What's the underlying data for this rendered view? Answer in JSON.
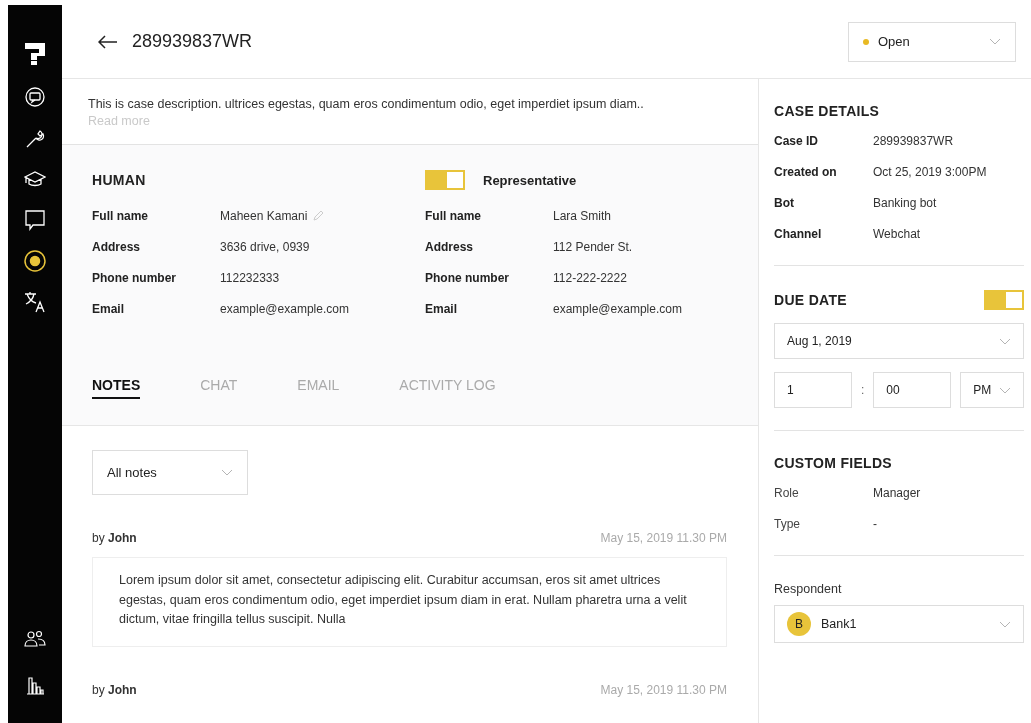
{
  "sidebar": {
    "items": [
      {
        "kind": "chat-sync",
        "selected": false
      },
      {
        "kind": "wrench",
        "selected": false
      },
      {
        "kind": "cap",
        "selected": false
      },
      {
        "kind": "bubble",
        "selected": false
      },
      {
        "kind": "target",
        "selected": true
      },
      {
        "kind": "translate",
        "selected": false
      }
    ],
    "bottom_items": [
      {
        "kind": "people",
        "selected": false
      },
      {
        "kind": "chart",
        "selected": false
      }
    ]
  },
  "header": {
    "title": "289939837WR",
    "status": {
      "label": "Open",
      "color": "#e8b923"
    }
  },
  "description": {
    "text": "This is case description. ultrices egestas, quam eros condimentum odio, eget imperdiet ipsum diam..",
    "link": "Read more"
  },
  "human": {
    "title": "HUMAN",
    "fields": [
      {
        "label": "Full name",
        "value": "Maheen Kamani",
        "editable": true
      },
      {
        "label": "Address",
        "value": "3636 drive, 0939",
        "editable": false
      },
      {
        "label": "Phone number",
        "value": "112232333",
        "editable": false
      },
      {
        "label": "Email",
        "value": "example@example.com",
        "editable": false
      }
    ]
  },
  "representative": {
    "title": "Representative",
    "on": true,
    "fields": [
      {
        "label": "Full name",
        "value": "Lara Smith"
      },
      {
        "label": "Address",
        "value": "112 Pender St."
      },
      {
        "label": "Phone number",
        "value": "112-222-2222"
      },
      {
        "label": "Email",
        "value": "example@example.com"
      }
    ]
  },
  "tabs": [
    {
      "label": "NOTES",
      "selected": true
    },
    {
      "label": "CHAT",
      "selected": false
    },
    {
      "label": "EMAIL",
      "selected": false
    },
    {
      "label": "ACTIVITY LOG",
      "selected": false
    }
  ],
  "notes_filter": {
    "value": "All notes"
  },
  "notes": [
    {
      "author": "by **John**",
      "time": "May 15, 2019 11.30 PM",
      "text": "Lorem ipsum dolor sit amet, consectetur adipiscing elit. Curabitur accumsan, eros sit amet ultrices egestas, quam eros condimentum odio, eget imperdiet ipsum diam in erat. Nullam pharetra urna a velit dictum, vitae fringilla tellus suscipit. Nulla"
    },
    {
      "author": "by **John**",
      "time": "May 15, 2019 11.30 PM"
    }
  ],
  "case_details": {
    "title": "CASE DETAILS",
    "fields": [
      {
        "label": "Case ID",
        "value": "289939837WR"
      },
      {
        "label": "Created on",
        "value": "Oct 25, 2019 3:00PM"
      },
      {
        "label": "Bot",
        "value": "Banking bot"
      },
      {
        "label": "Channel",
        "value": "Webchat"
      }
    ]
  },
  "due_date": {
    "title": "DUE DATE",
    "on": true,
    "date": "Aug 1, 2019",
    "hour": "1",
    "separator": ":",
    "minute": "00",
    "period": "PM"
  },
  "custom_fields": {
    "title": "CUSTOM FIELDS",
    "fields": [
      {
        "label": "Role",
        "value": "Manager"
      },
      {
        "label": "Type",
        "value": "-"
      }
    ]
  },
  "respondent": {
    "label": "Respondent",
    "avatar": "B",
    "value": "Bank1"
  }
}
